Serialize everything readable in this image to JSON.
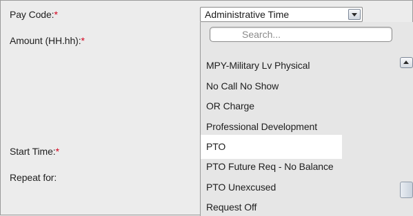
{
  "form": {
    "pay_code_label": "Pay Code:",
    "amount_label": "Amount (HH.hh):",
    "start_time_label": "Start Time:",
    "repeat_label": "Repeat for:",
    "required_marker": "*"
  },
  "pay_code_select": {
    "value": "Administrative Time"
  },
  "dropdown": {
    "search_placeholder": "Search...",
    "items": [
      "MPY-Military Lv Physical",
      "No Call No Show",
      "OR Charge",
      "Professional Development",
      "PTO",
      "PTO Future Req - No Balance",
      "PTO Unexcused",
      "Request Off"
    ],
    "highlighted_item": "PTO"
  },
  "colors": {
    "required": "#d4001c",
    "background": "#ececec",
    "highlight": "#ffffff"
  }
}
